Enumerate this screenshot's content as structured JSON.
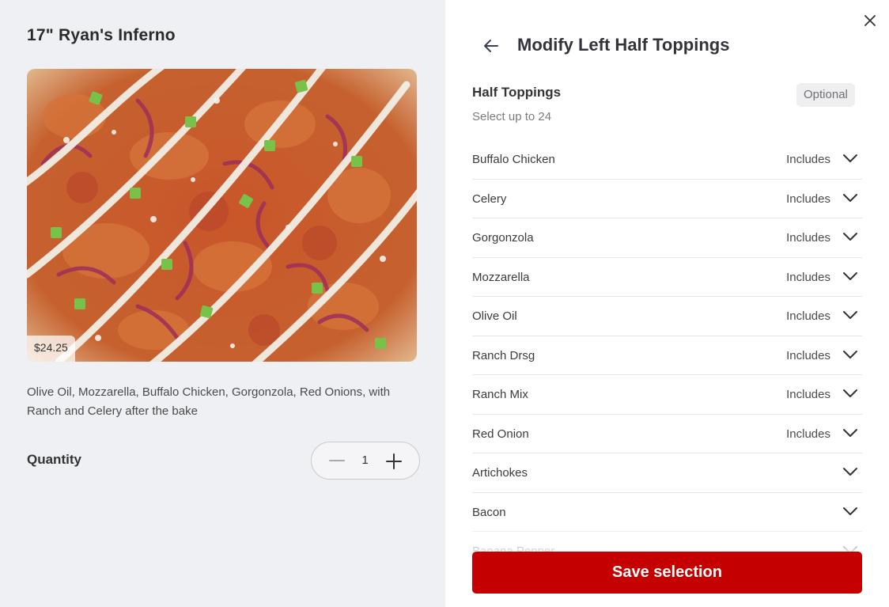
{
  "item": {
    "title": "17\" Ryan's Inferno",
    "price": "$24.25",
    "description": "Olive Oil, Mozzarella, Buffalo Chicken, Gorgonzola, Red Onions, with Ranch and Celery after the bake",
    "image_alt": "pizza-photo"
  },
  "quantity": {
    "label": "Quantity",
    "value": "1",
    "decrement_icon": "minus-icon",
    "increment_icon": "plus-icon"
  },
  "modifier_panel": {
    "title": "Modify Left Half Toppings",
    "back_icon": "arrow-left-icon",
    "close_icon": "close-icon",
    "section_title": "Half Toppings",
    "section_subtitle": "Select up to 24",
    "badge": "Optional",
    "toppings": [
      {
        "name": "Buffalo Chicken",
        "status": "Includes"
      },
      {
        "name": "Celery",
        "status": "Includes"
      },
      {
        "name": "Gorgonzola",
        "status": "Includes"
      },
      {
        "name": "Mozzarella",
        "status": "Includes"
      },
      {
        "name": "Olive Oil",
        "status": "Includes"
      },
      {
        "name": "Ranch Drsg",
        "status": "Includes"
      },
      {
        "name": "Ranch Mix",
        "status": "Includes"
      },
      {
        "name": "Red Onion",
        "status": "Includes"
      },
      {
        "name": "Artichokes",
        "status": ""
      },
      {
        "name": "Bacon",
        "status": ""
      },
      {
        "name": "Banana Pepper",
        "status": ""
      }
    ],
    "save_label": "Save selection"
  },
  "colors": {
    "accent": "#c40000",
    "left_background": "#eff0f4"
  }
}
